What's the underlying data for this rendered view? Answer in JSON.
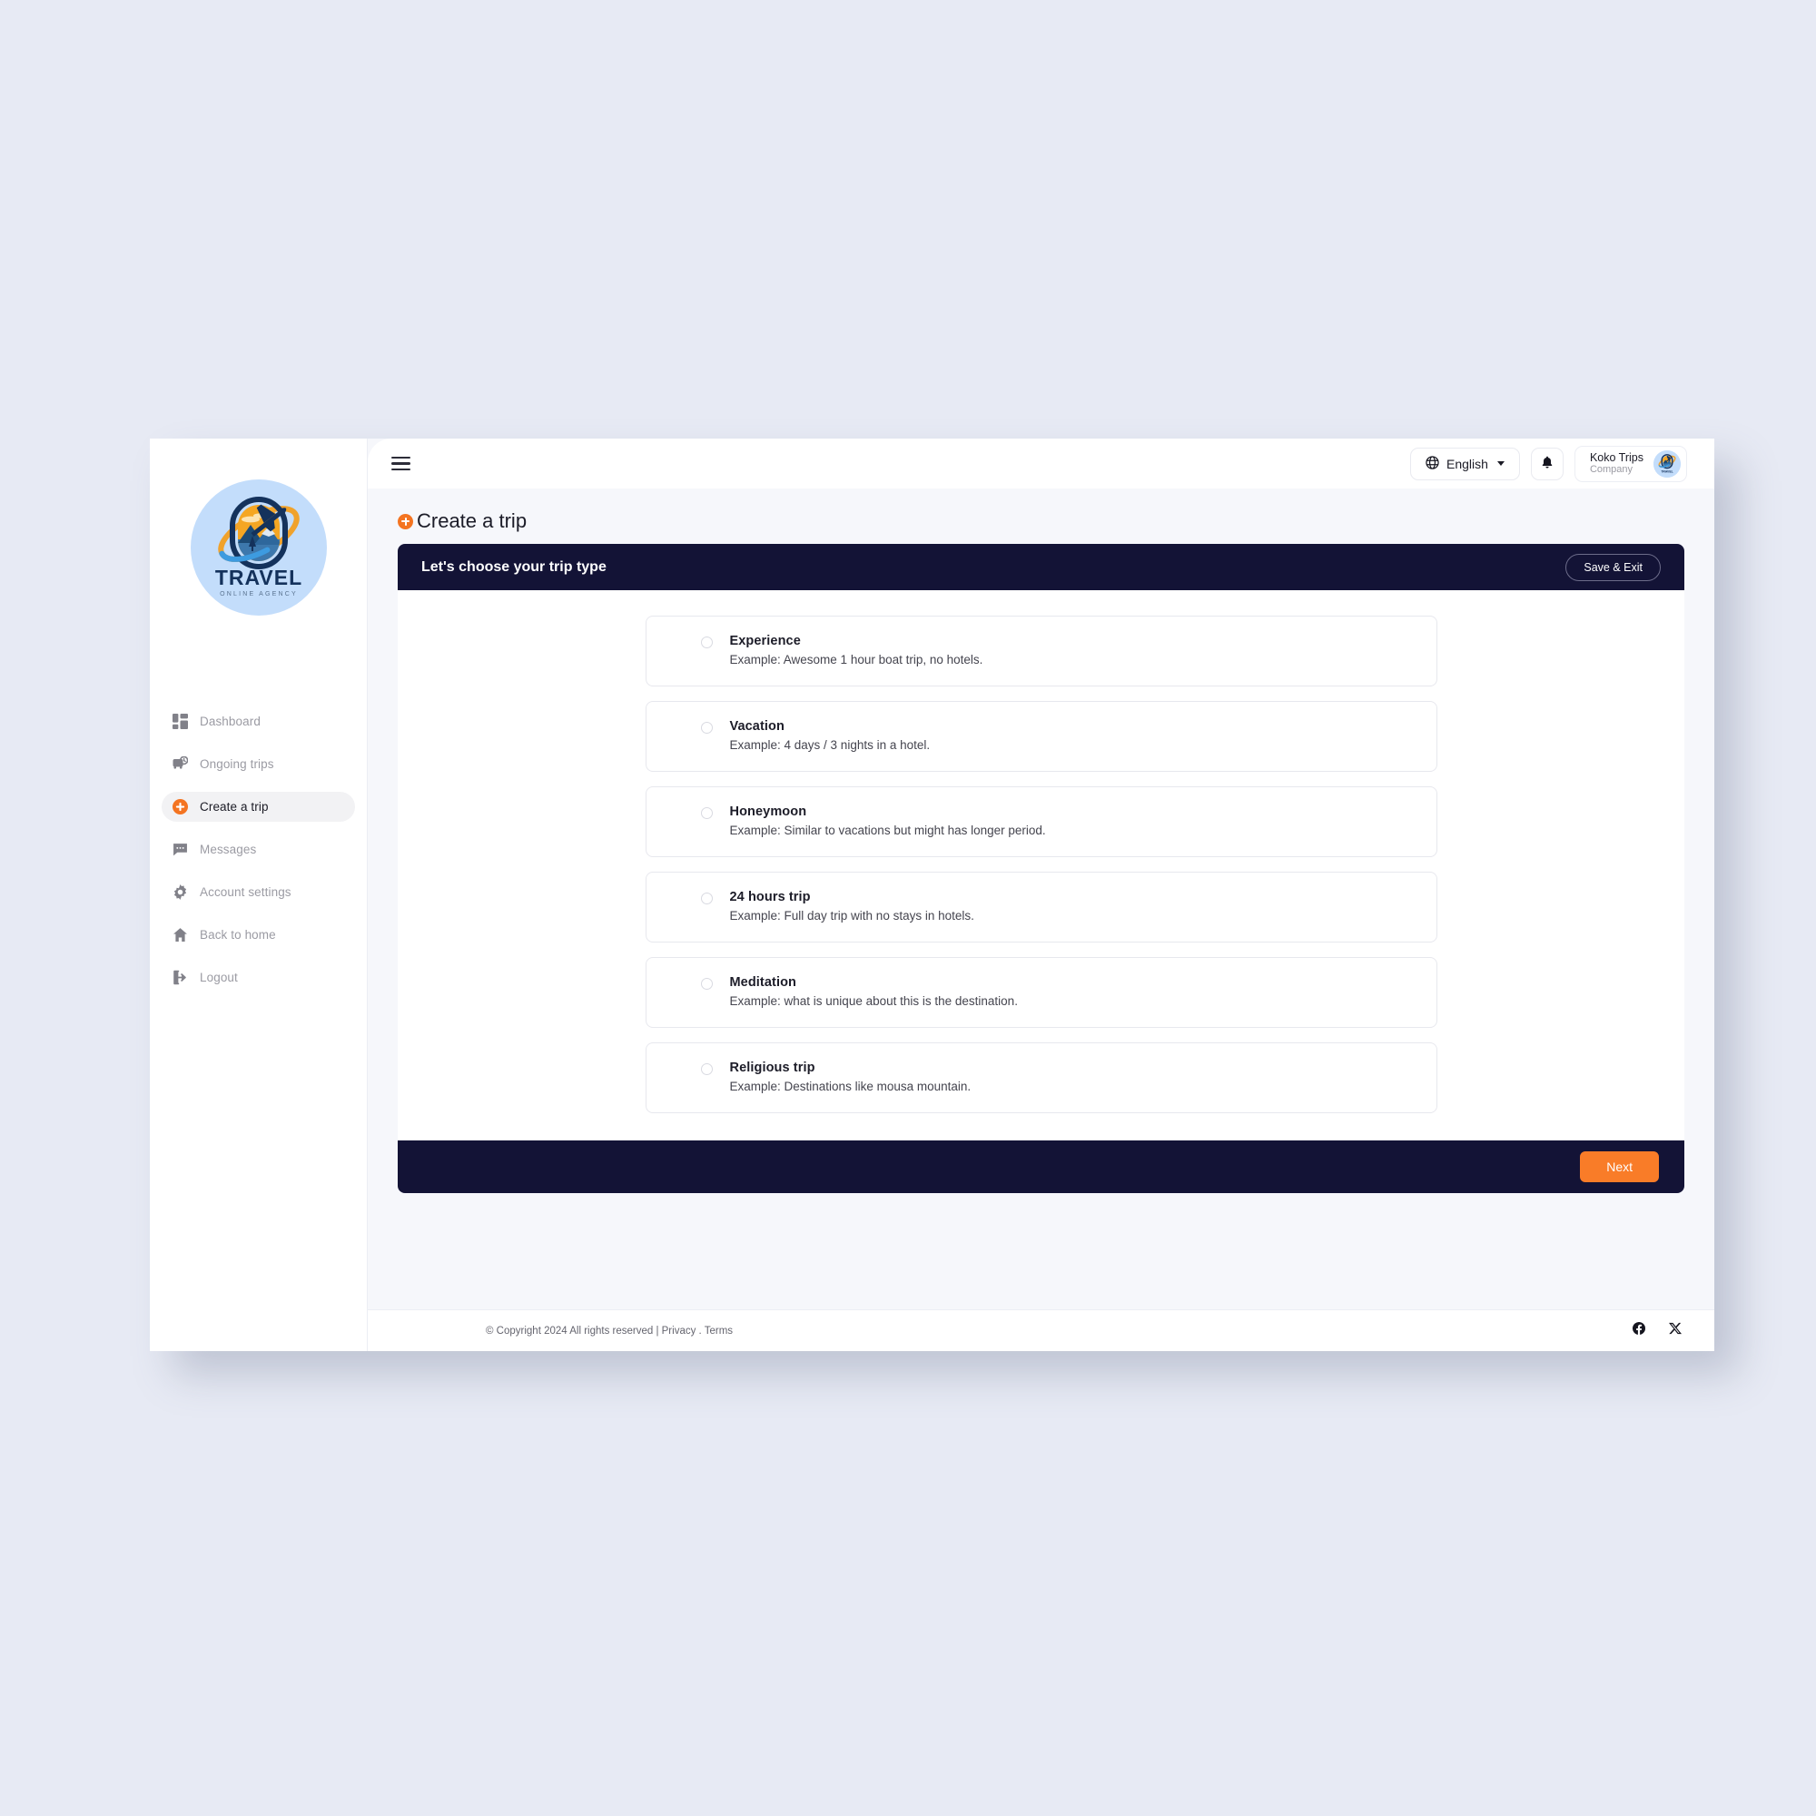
{
  "sidebar": {
    "logo": {
      "brand": "TRAVEL",
      "tagline": "ONLINE AGENCY",
      "icon": "travel-globe-plane-logo"
    },
    "items": [
      {
        "label": "Dashboard",
        "icon": "dashboard-icon",
        "active": false
      },
      {
        "label": "Ongoing trips",
        "icon": "ongoing-trips-icon",
        "active": false
      },
      {
        "label": "Create a trip",
        "icon": "plus-circle-icon",
        "active": true
      },
      {
        "label": "Messages",
        "icon": "message-icon",
        "active": false
      },
      {
        "label": "Account settings",
        "icon": "gear-icon",
        "active": false
      },
      {
        "label": "Back to home",
        "icon": "home-icon",
        "active": false
      },
      {
        "label": "Logout",
        "icon": "logout-icon",
        "active": false
      }
    ]
  },
  "topbar": {
    "menu_icon": "hamburger-icon",
    "language": {
      "label": "English",
      "icon": "globe-icon",
      "caret": "chevron-down-icon"
    },
    "notifications": {
      "icon": "bell-icon"
    },
    "profile": {
      "name": "Koko Trips",
      "role": "Company",
      "avatar": "company-logo-avatar"
    }
  },
  "page": {
    "title": "Create a trip",
    "title_icon": "plus-circle-icon"
  },
  "wizard": {
    "header_title": "Let's choose your trip type",
    "save_exit_label": "Save & Exit",
    "next_label": "Next",
    "options": [
      {
        "title": "Experience",
        "desc": "Example: Awesome 1 hour boat trip, no hotels.",
        "selected": false
      },
      {
        "title": "Vacation",
        "desc": "Example: 4 days / 3 nights in a hotel.",
        "selected": false
      },
      {
        "title": "Honeymoon",
        "desc": "Example: Similar to vacations but might has longer period.",
        "selected": false
      },
      {
        "title": "24 hours trip",
        "desc": "Example: Full day trip with no stays in hotels.",
        "selected": false
      },
      {
        "title": "Meditation",
        "desc": "Example: what is unique about this is the destination.",
        "selected": false
      },
      {
        "title": "Religious trip",
        "desc": "Example: Destinations like mousa mountain.",
        "selected": false
      }
    ]
  },
  "footer": {
    "copyright": "© Copyright 2024 All rights reserved | Privacy . Terms",
    "social": [
      {
        "name": "facebook-icon"
      },
      {
        "name": "x-twitter-icon"
      }
    ]
  },
  "colors": {
    "accent_orange": "#f47421",
    "next_orange": "#f97c28",
    "dark_navy": "#131336",
    "page_bg": "#e7eaf4",
    "content_bg": "#f6f7fb"
  }
}
